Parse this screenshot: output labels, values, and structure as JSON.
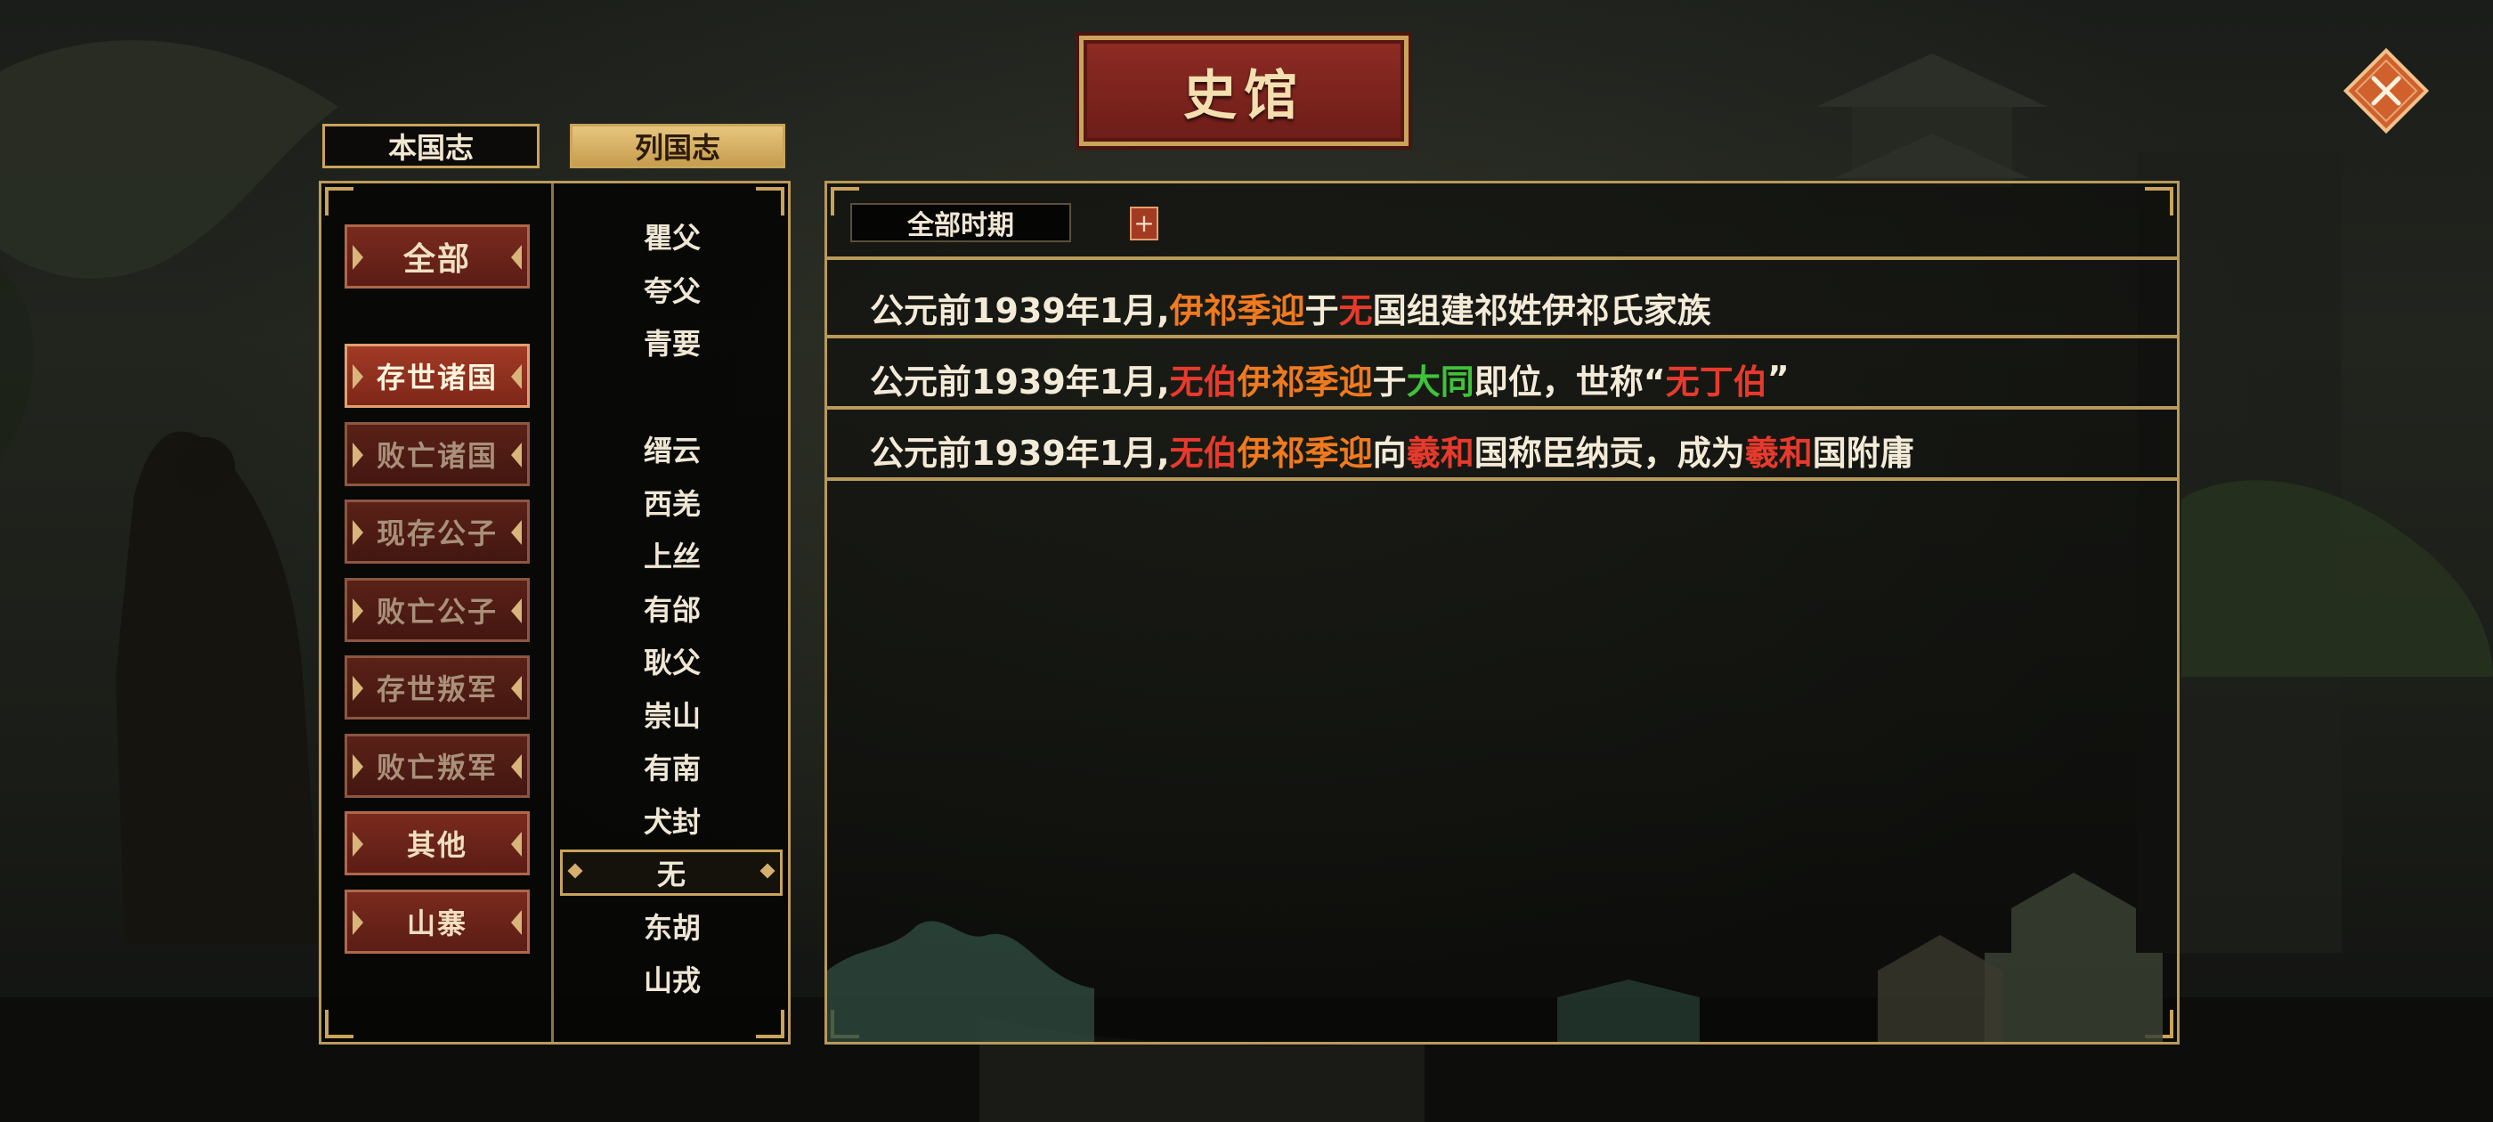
{
  "window_title": "史馆",
  "colors": {
    "accent_red": "#e83a2c",
    "accent_orange": "#f07a1e",
    "accent_green": "#3fc23a",
    "gold_border": "#c9a45a"
  },
  "tabs": [
    {
      "label": "本国志",
      "active": false
    },
    {
      "label": "列国志",
      "active": true
    }
  ],
  "categories": [
    {
      "label": "全部"
    },
    {
      "label": "存世诸国",
      "active": true
    },
    {
      "label": "败亡诸国"
    },
    {
      "label": "现存公子"
    },
    {
      "label": "败亡公子"
    },
    {
      "label": "存世叛军"
    },
    {
      "label": "败亡叛军"
    },
    {
      "label": "其他"
    },
    {
      "label": "山寨"
    }
  ],
  "nations": [
    "瞿父",
    "夸父",
    "青要",
    "",
    "缙云",
    "西羌",
    "上丝",
    "有邰",
    "耿父",
    "崇山",
    "有南",
    "犬封",
    "无",
    "东胡",
    "山戎"
  ],
  "selected_nation": "无",
  "period_filter": {
    "value": "全部时期",
    "plus_label": "+"
  },
  "records": [
    {
      "parts": [
        {
          "t": "公元前1939年1月,",
          "c": ""
        },
        {
          "t": "伊祁季迎",
          "c": "o"
        },
        {
          "t": "于",
          "c": ""
        },
        {
          "t": "无",
          "c": "r"
        },
        {
          "t": "国组建祁姓伊祁氏家族",
          "c": ""
        }
      ]
    },
    {
      "parts": [
        {
          "t": "公元前1939年1月,",
          "c": ""
        },
        {
          "t": "无伯",
          "c": "r"
        },
        {
          "t": "伊祁季迎",
          "c": "o"
        },
        {
          "t": "于",
          "c": ""
        },
        {
          "t": "大同",
          "c": "g"
        },
        {
          "t": "即位，世称“",
          "c": ""
        },
        {
          "t": "无丁伯",
          "c": "r"
        },
        {
          "t": "”",
          "c": ""
        }
      ]
    },
    {
      "parts": [
        {
          "t": "公元前1939年1月,",
          "c": ""
        },
        {
          "t": "无伯",
          "c": "r"
        },
        {
          "t": "伊祁季迎",
          "c": "o"
        },
        {
          "t": "向",
          "c": ""
        },
        {
          "t": "羲和",
          "c": "r"
        },
        {
          "t": "国称臣纳贡，成为",
          "c": ""
        },
        {
          "t": "羲和",
          "c": "r"
        },
        {
          "t": "国附庸",
          "c": ""
        }
      ]
    }
  ]
}
